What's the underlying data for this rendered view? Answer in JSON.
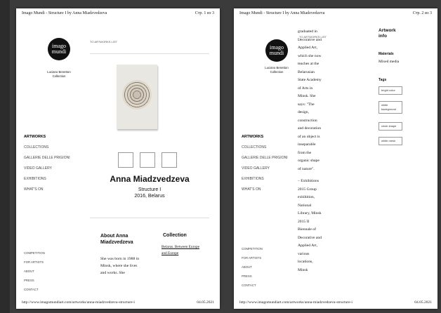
{
  "page1": {
    "header_title": "Imago Mundi - Structure I by Anna Miadzvedzeva",
    "page_no": "Стр. 1 из 3",
    "logo_line1": "imago",
    "logo_line2": "mundi",
    "collection_line1": "Luciano Benetton",
    "collection_line2": "Collection",
    "back_link": "TO ARTWORKS LIST",
    "nav": [
      "ARTWORKS",
      "COLLECTIONS",
      "GALLERIE DELLE PRIGIONI",
      "VIDEO GALLERY",
      "EXHIBITIONS",
      "WHAT'S ON"
    ],
    "bottom_nav": [
      "COMPETITION",
      "FOR ARTISTS",
      "ABOUT",
      "PRESS",
      "CONTACT"
    ],
    "artist": "Anna Miadzvedzeva",
    "artwork_title": "Structure I",
    "year_country": "2016, Belarus",
    "about_title": "About Anna Miadzvedzeva",
    "collection_title": "Collection",
    "collection_link": "Belarus. Between Europe and Europe",
    "bio": "She was born in 1988 in Minsk, where she lives and works. She",
    "footer_url": "http://www.imagomundiart.com/artworks/anna-miadzvedzeva-structure-i",
    "footer_date": "04.05.2021"
  },
  "page2": {
    "header_title": "Imago Mundi - Structure I by Anna Miadzvedzeva",
    "page_no": "Стр. 2 из 3",
    "logo_line1": "imago",
    "logo_line2": "mundi",
    "collection_line1": "Luciano Benetton",
    "collection_line2": "Collection",
    "back_link": "TO ARTWORKS LIST",
    "bio_lines": [
      "graduated in",
      "Decorative and",
      "Applied Art,",
      "which she now",
      "teaches at the",
      "Belarusian",
      "State Academy",
      "of Arts in",
      "Minsk. She",
      "says: \"The",
      "design,",
      "construction",
      "and decoration",
      "of an object is",
      "inseparable",
      "from the",
      "organic shape",
      "of nature\".",
      "",
      "– Exhibitions",
      "2015 Group",
      "exhibition,",
      "National",
      "Library, Minsk",
      "2015 II",
      "Biennale of",
      "Decorative and",
      "Applied Art,",
      "various",
      "locations,",
      "Minsk"
    ],
    "info_title_1": "Artwork",
    "info_title_2": "info",
    "materials_label": "Materials",
    "materials_value": "Mixed media",
    "tags_label": "Tags",
    "tags": [
      "bright color",
      "white background",
      "circle shape",
      "white mesh"
    ],
    "nav": [
      "ARTWORKS",
      "COLLECTIONS",
      "GALLERIE DELLE PRIGIONI",
      "VIDEO GALLERY",
      "EXHIBITIONS",
      "WHAT'S ON"
    ],
    "bottom_nav": [
      "COMPETITION",
      "FOR ARTISTS",
      "ABOUT",
      "PRESS",
      "CONTACT"
    ],
    "footer_url": "http://www.imagomundiart.com/artworks/anna-miadzvedzeva-structure-i",
    "footer_date": "04.05.2021"
  }
}
